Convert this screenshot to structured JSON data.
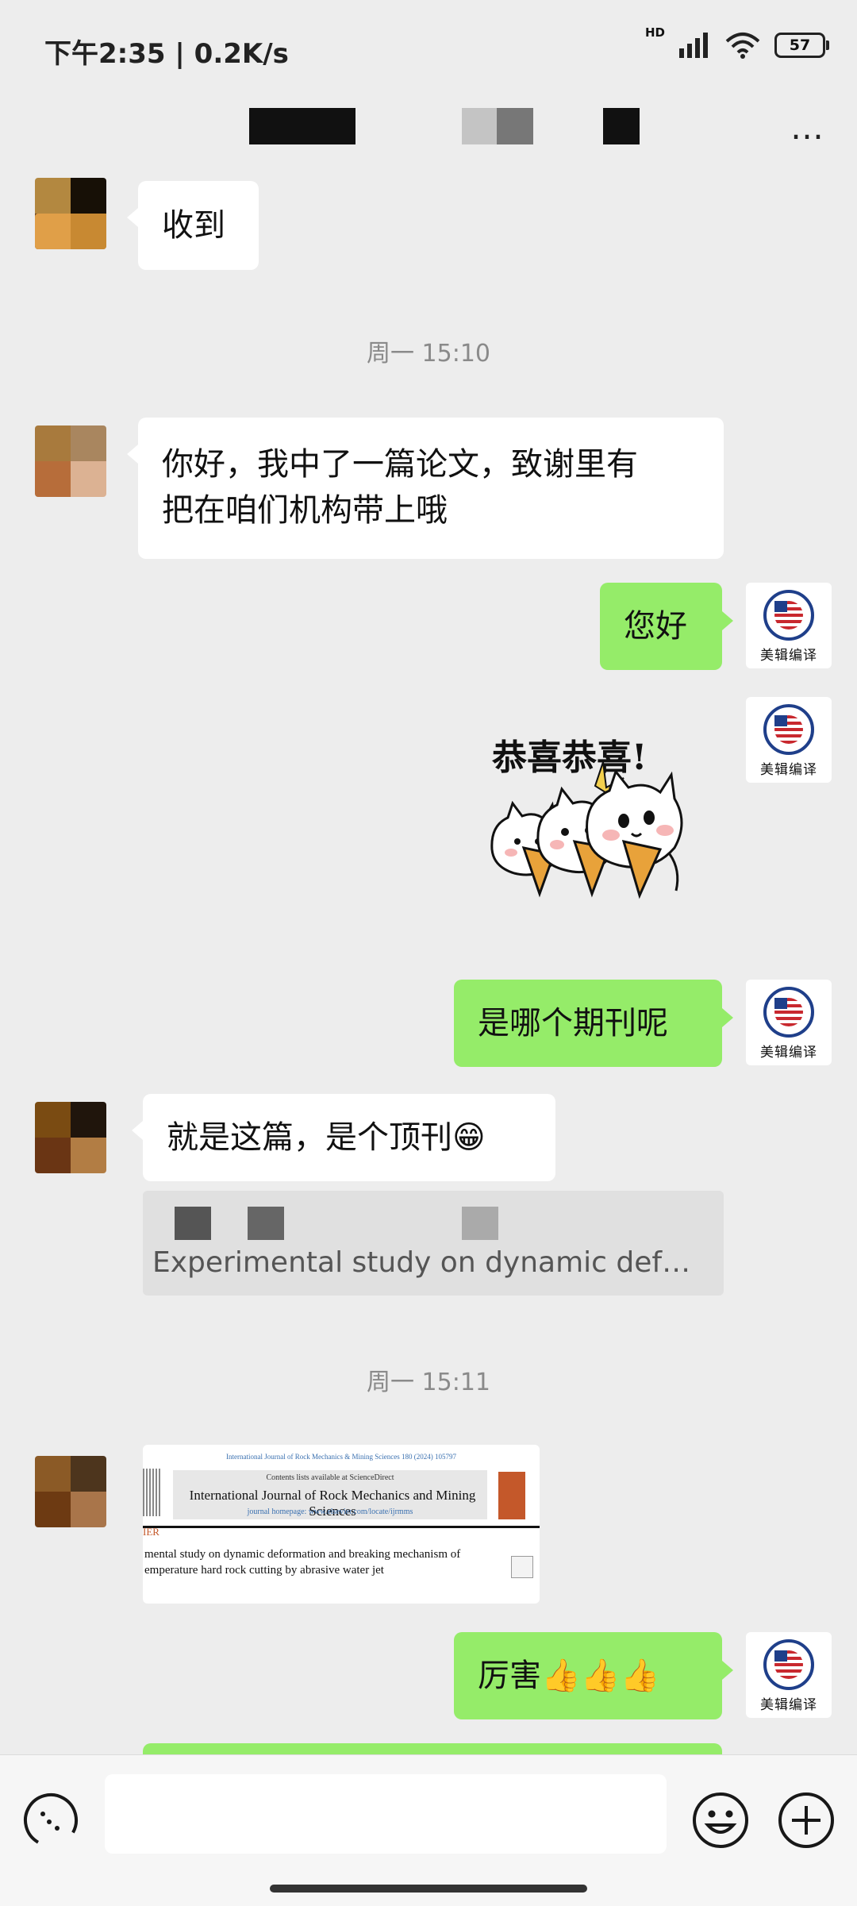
{
  "status_bar": {
    "time": "下午2:35 | 0.2K/s",
    "network_label": "HD",
    "battery": "57"
  },
  "header": {
    "more_label": "…"
  },
  "messages": {
    "m1": "收到",
    "ts1": "周一 15:10",
    "m2_line1": "你好，我中了一篇论文，致谢里有",
    "m2_line2": "把在咱们机构带上哦",
    "m3": "您好",
    "sticker_text": "恭喜恭喜!",
    "m4": "是哪个期刊呢",
    "m5": "就是这篇，是个顶刊😁",
    "quote": "Experimental study on dynamic def…",
    "ts2": "周一 15:11",
    "m6": "厉害👍👍👍"
  },
  "logo_avatar": {
    "text": "美辑编译"
  },
  "paper": {
    "top_line": "International Journal of Rock Mechanics & Mining Sciences 180 (2024) 105797",
    "available": "Contents lists available at ScienceDirect",
    "journal": "International Journal of Rock Mechanics and Mining Sciences",
    "homepage": "journal homepage: www.elsevier.com/locate/ijrmms",
    "side_tag": "IER",
    "title_line1": "mental study on dynamic deformation and breaking mechanism of",
    "title_line2": "emperature hard rock cutting by abrasive water jet"
  },
  "input": {
    "value": ""
  },
  "colors": {
    "green_bubble": "#95ec69",
    "white_bubble": "#ffffff",
    "background": "#ededed"
  }
}
